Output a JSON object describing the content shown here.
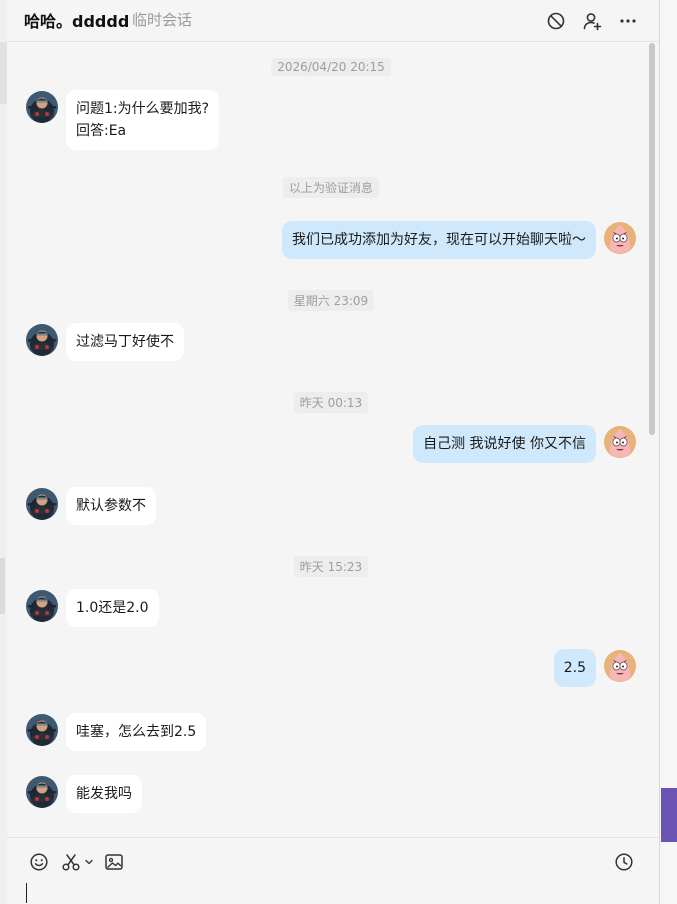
{
  "header": {
    "title": "哈哈。ddddd",
    "subtitle": "临时会话",
    "icons": [
      "block-icon",
      "add-friend-icon",
      "more-icon"
    ]
  },
  "messages": [
    {
      "type": "time",
      "text": "2026/04/20 20:15"
    },
    {
      "type": "msg",
      "side": "left",
      "avatar": "ninja-avatar",
      "lines": [
        "问题1:为什么要加我?",
        "回答:Ea"
      ]
    },
    {
      "type": "system",
      "text": "以上为验证消息"
    },
    {
      "type": "msg",
      "side": "right",
      "avatar": "patrick-avatar",
      "lines": [
        "我们已成功添加为好友，现在可以开始聊天啦～"
      ]
    },
    {
      "type": "time",
      "text": "星期六 23:09"
    },
    {
      "type": "msg",
      "side": "left",
      "avatar": "ninja-avatar",
      "lines": [
        "过滤马丁好使不"
      ]
    },
    {
      "type": "time",
      "text": "昨天 00:13"
    },
    {
      "type": "msg",
      "side": "right",
      "avatar": "patrick-avatar",
      "lines": [
        "自己测 我说好使 你又不信"
      ]
    },
    {
      "type": "msg",
      "side": "left",
      "avatar": "ninja-avatar",
      "lines": [
        "默认参数不"
      ]
    },
    {
      "type": "time",
      "text": "昨天 15:23"
    },
    {
      "type": "msg",
      "side": "left",
      "avatar": "ninja-avatar",
      "lines": [
        "1.0还是2.0"
      ]
    },
    {
      "type": "msg",
      "side": "right",
      "avatar": "patrick-avatar",
      "lines": [
        "2.5"
      ]
    },
    {
      "type": "msg",
      "side": "left",
      "avatar": "ninja-avatar",
      "lines": [
        "哇塞，怎么去到2.5"
      ]
    },
    {
      "type": "msg",
      "side": "left",
      "avatar": "ninja-avatar",
      "lines": [
        "能发我吗"
      ]
    }
  ],
  "composer": {
    "tools": [
      "emoji-icon",
      "screenshot-scissors-icon",
      "image-icon",
      "history-clock-icon"
    ],
    "value": ""
  },
  "colors": {
    "bubble_self": "#cfe8fb",
    "bubble_other": "#ffffff",
    "background": "#f5f5f5",
    "accent": "#6b52b5"
  }
}
